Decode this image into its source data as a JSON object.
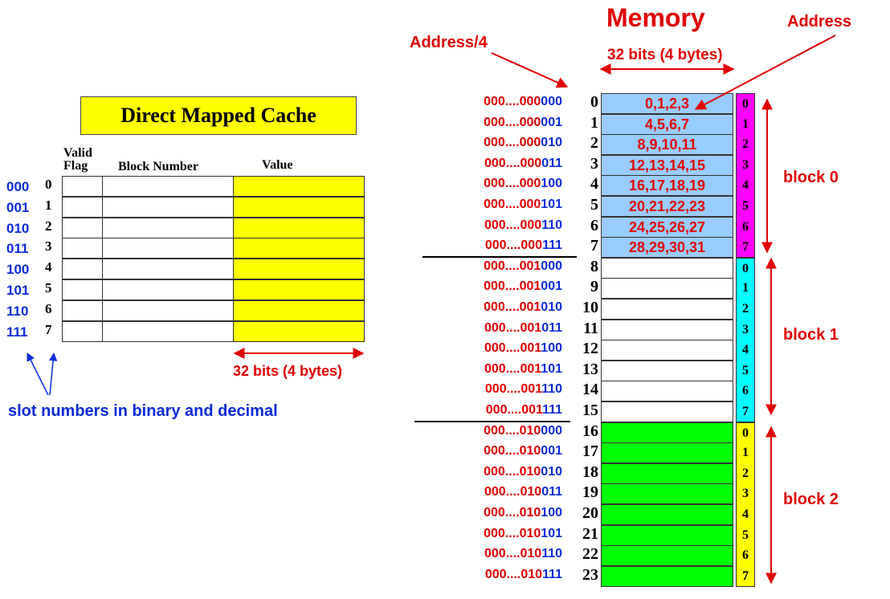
{
  "memory_title": "Memory",
  "address_label": "Address",
  "address4_label": "Address/4",
  "mem_width_label": "32 bits (4 bytes)",
  "cache": {
    "title": "Direct Mapped Cache",
    "col_valid_line1": "Valid",
    "col_valid_line2": "Flag",
    "col_block": "Block Number",
    "col_value": "Value",
    "width_label": "32 bits (4 bytes)",
    "slots": [
      {
        "bin": "000",
        "dec": "0"
      },
      {
        "bin": "001",
        "dec": "1"
      },
      {
        "bin": "010",
        "dec": "2"
      },
      {
        "bin": "011",
        "dec": "3"
      },
      {
        "bin": "100",
        "dec": "4"
      },
      {
        "bin": "101",
        "dec": "5"
      },
      {
        "bin": "110",
        "dec": "6"
      },
      {
        "bin": "111",
        "dec": "7"
      }
    ],
    "slot_caption": "slot numbers in binary and decimal"
  },
  "memory": {
    "addr_prefix": "000....",
    "rows": [
      {
        "addr_red": "000",
        "addr_blue": "000",
        "index": "0",
        "value": "0,1,2,3",
        "offset": "0"
      },
      {
        "addr_red": "000",
        "addr_blue": "001",
        "index": "1",
        "value": "4,5,6,7",
        "offset": "1"
      },
      {
        "addr_red": "000",
        "addr_blue": "010",
        "index": "2",
        "value": "8,9,10,11",
        "offset": "2"
      },
      {
        "addr_red": "000",
        "addr_blue": "011",
        "index": "3",
        "value": "12,13,14,15",
        "offset": "3"
      },
      {
        "addr_red": "000",
        "addr_blue": "100",
        "index": "4",
        "value": "16,17,18,19",
        "offset": "4"
      },
      {
        "addr_red": "000",
        "addr_blue": "101",
        "index": "5",
        "value": "20,21,22,23",
        "offset": "5"
      },
      {
        "addr_red": "000",
        "addr_blue": "110",
        "index": "6",
        "value": "24,25,26,27",
        "offset": "6"
      },
      {
        "addr_red": "000",
        "addr_blue": "111",
        "index": "7",
        "value": "28,29,30,31",
        "offset": "7"
      },
      {
        "addr_red": "001",
        "addr_blue": "000",
        "index": "8",
        "value": "",
        "offset": "0"
      },
      {
        "addr_red": "001",
        "addr_blue": "001",
        "index": "9",
        "value": "",
        "offset": "1"
      },
      {
        "addr_red": "001",
        "addr_blue": "010",
        "index": "10",
        "value": "",
        "offset": "2"
      },
      {
        "addr_red": "001",
        "addr_blue": "011",
        "index": "11",
        "value": "",
        "offset": "3"
      },
      {
        "addr_red": "001",
        "addr_blue": "100",
        "index": "12",
        "value": "",
        "offset": "4"
      },
      {
        "addr_red": "001",
        "addr_blue": "101",
        "index": "13",
        "value": "",
        "offset": "5"
      },
      {
        "addr_red": "001",
        "addr_blue": "110",
        "index": "14",
        "value": "",
        "offset": "6"
      },
      {
        "addr_red": "001",
        "addr_blue": "111",
        "index": "15",
        "value": "",
        "offset": "7"
      },
      {
        "addr_red": "010",
        "addr_blue": "000",
        "index": "16",
        "value": "",
        "offset": "0"
      },
      {
        "addr_red": "010",
        "addr_blue": "001",
        "index": "17",
        "value": "",
        "offset": "1"
      },
      {
        "addr_red": "010",
        "addr_blue": "010",
        "index": "18",
        "value": "",
        "offset": "2"
      },
      {
        "addr_red": "010",
        "addr_blue": "011",
        "index": "19",
        "value": "",
        "offset": "3"
      },
      {
        "addr_red": "010",
        "addr_blue": "100",
        "index": "20",
        "value": "",
        "offset": "4"
      },
      {
        "addr_red": "010",
        "addr_blue": "101",
        "index": "21",
        "value": "",
        "offset": "5"
      },
      {
        "addr_red": "010",
        "addr_blue": "110",
        "index": "22",
        "value": "",
        "offset": "6"
      },
      {
        "addr_red": "010",
        "addr_blue": "111",
        "index": "23",
        "value": "",
        "offset": "7"
      }
    ],
    "blocks": [
      {
        "label": "block 0",
        "fill": "#99ccff",
        "offset_fill": "#ff00ff"
      },
      {
        "label": "block 1",
        "fill": "#ffffff",
        "offset_fill": "#00ffff"
      },
      {
        "label": "block 2",
        "fill": "#00ff00",
        "offset_fill": "#ffff00"
      }
    ]
  },
  "colors": {
    "red": "#e00000",
    "blue": "#0a2bd6",
    "cache_value_fill": "#ffff00",
    "title_fill": "#ffff00"
  }
}
